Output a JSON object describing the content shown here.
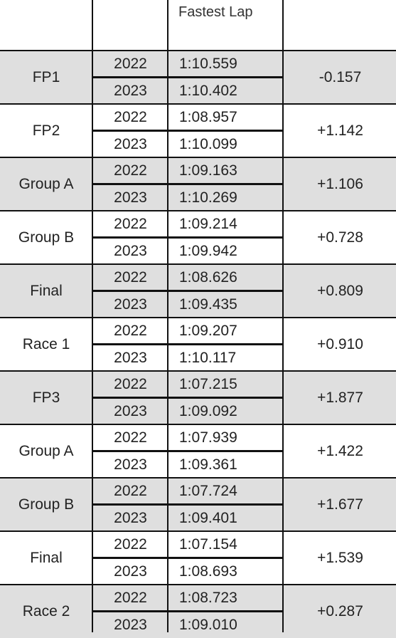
{
  "table": {
    "header": {
      "col1": "",
      "col2": "",
      "col3": "Fastest Lap",
      "col4": ""
    },
    "groups": [
      {
        "session": "FP1",
        "rows": [
          {
            "year": "2022",
            "lap": "1:10.559"
          },
          {
            "year": "2023",
            "lap": "1:10.402"
          }
        ],
        "delta": "-0.157",
        "shaded": true
      },
      {
        "session": "FP2",
        "rows": [
          {
            "year": "2022",
            "lap": "1:08.957"
          },
          {
            "year": "2023",
            "lap": "1:10.099"
          }
        ],
        "delta": "+1.142",
        "shaded": false
      },
      {
        "session": "Group A",
        "rows": [
          {
            "year": "2022",
            "lap": "1:09.163"
          },
          {
            "year": "2023",
            "lap": "1:10.269"
          }
        ],
        "delta": "+1.106",
        "shaded": true
      },
      {
        "session": "Group B",
        "rows": [
          {
            "year": "2022",
            "lap": "1:09.214"
          },
          {
            "year": "2023",
            "lap": "1:09.942"
          }
        ],
        "delta": "+0.728",
        "shaded": false
      },
      {
        "session": "Final",
        "rows": [
          {
            "year": "2022",
            "lap": "1:08.626"
          },
          {
            "year": "2023",
            "lap": "1:09.435"
          }
        ],
        "delta": "+0.809",
        "shaded": true
      },
      {
        "session": "Race 1",
        "rows": [
          {
            "year": "2022",
            "lap": "1:09.207"
          },
          {
            "year": "2023",
            "lap": "1:10.117"
          }
        ],
        "delta": "+0.910",
        "shaded": false
      },
      {
        "session": "FP3",
        "rows": [
          {
            "year": "2022",
            "lap": "1:07.215"
          },
          {
            "year": "2023",
            "lap": "1:09.092"
          }
        ],
        "delta": "+1.877",
        "shaded": true
      },
      {
        "session": "Group A",
        "rows": [
          {
            "year": "2022",
            "lap": "1:07.939"
          },
          {
            "year": "2023",
            "lap": "1:09.361"
          }
        ],
        "delta": "+1.422",
        "shaded": false
      },
      {
        "session": "Group B",
        "rows": [
          {
            "year": "2022",
            "lap": "1:07.724"
          },
          {
            "year": "2023",
            "lap": "1:09.401"
          }
        ],
        "delta": "+1.677",
        "shaded": true
      },
      {
        "session": "Final",
        "rows": [
          {
            "year": "2022",
            "lap": "1:07.154"
          },
          {
            "year": "2023",
            "lap": "1:08.693"
          }
        ],
        "delta": "+1.539",
        "shaded": false
      },
      {
        "session": "Race 2",
        "rows": [
          {
            "year": "2022",
            "lap": "1:08.723"
          },
          {
            "year": "2023",
            "lap": "1:09.010"
          }
        ],
        "delta": "+0.287",
        "shaded": true
      }
    ]
  }
}
